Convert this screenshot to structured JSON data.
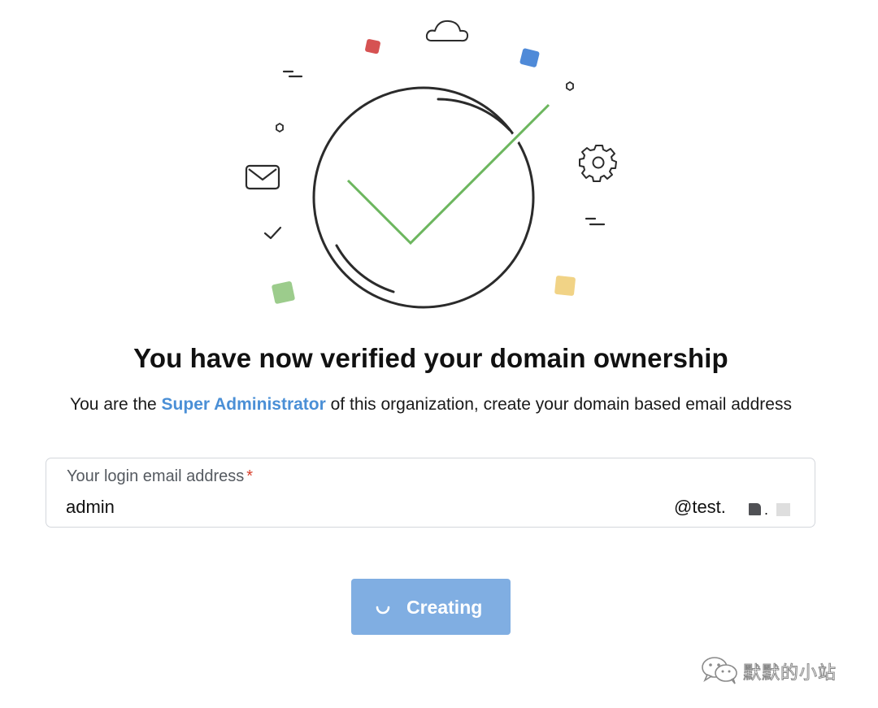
{
  "header": {
    "title": "You have now verified your domain ownership",
    "subtitle_prefix": "You are the ",
    "subtitle_role": "Super Administrator",
    "subtitle_suffix": " of this organization, create your domain based email address"
  },
  "email_field": {
    "label": "Your login email address",
    "required_mark": "*",
    "value": "admin",
    "domain_suffix": "@test.",
    "redacted_dot": "."
  },
  "submit": {
    "label": "Creating",
    "state": "loading"
  },
  "watermark": {
    "text": "默默的小站"
  },
  "colors": {
    "accent_link": "#4a8fd6",
    "button_bg": "#80aee2",
    "check_green": "#6cb65e",
    "required": "#d8402c"
  },
  "icons": {
    "illustration": "verified-check-circle",
    "decorations": [
      "cloud-icon",
      "mail-icon",
      "gear-icon",
      "small-check-icon"
    ],
    "button": "spinner-icon",
    "watermark": "wechat-icon"
  }
}
